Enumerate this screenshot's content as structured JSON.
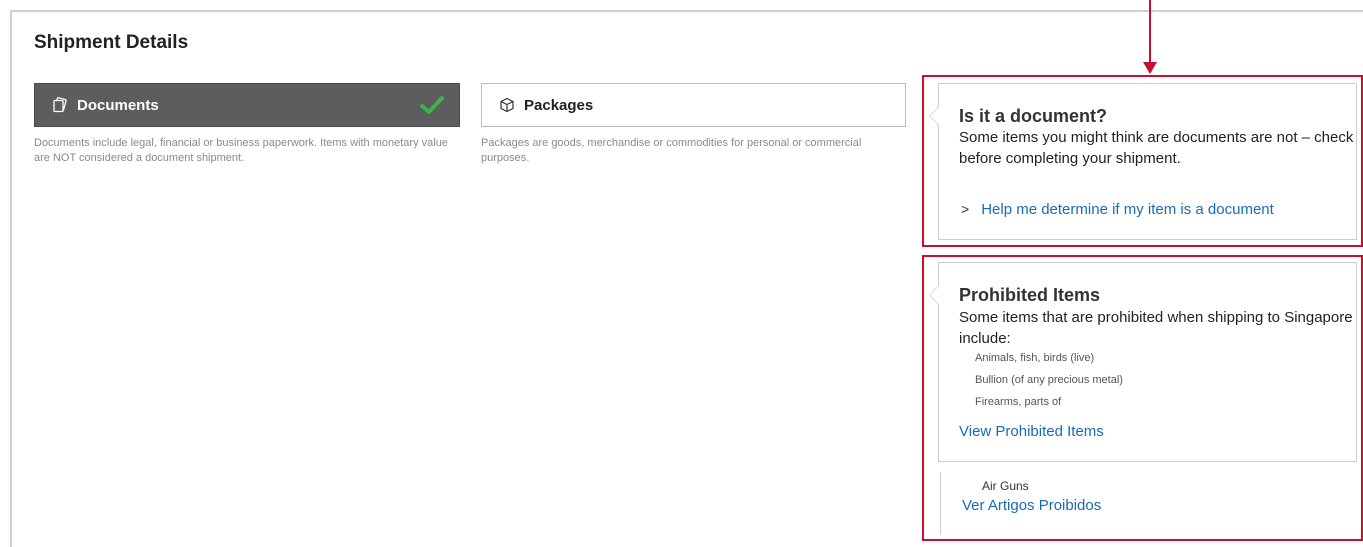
{
  "page": {
    "title": "Shipment Details"
  },
  "shipment_types": {
    "documents": {
      "label": "Documents",
      "icon": "documents-icon",
      "selected": true,
      "description": "Documents include legal, financial or business paperwork. Items with monetary value are NOT considered a document shipment."
    },
    "packages": {
      "label": "Packages",
      "icon": "package-icon",
      "selected": false,
      "description": "Packages are goods, merchandise or commodities for personal or commercial purposes."
    }
  },
  "document_info": {
    "title": "Is it a document?",
    "body": "Some items you might think are documents are not – check before completing your shipment.",
    "link_label": "Help me determine if my item is a document"
  },
  "prohibited": {
    "title": "Prohibited Items",
    "body": "Some items that are prohibited when shipping to Singapore include:",
    "items": [
      "Animals, fish, birds (live)",
      "Bullion (of any precious metal)",
      "Firearms, parts of"
    ],
    "view_link": "View Prohibited Items",
    "extra_item": "Air Guns",
    "extra_link": "Ver Artigos Proibidos"
  },
  "colors": {
    "accent_red": "#c8102e",
    "link_blue": "#1a6ab5",
    "selected_bg": "#5d5d5d",
    "check_green": "#3cb44a"
  }
}
